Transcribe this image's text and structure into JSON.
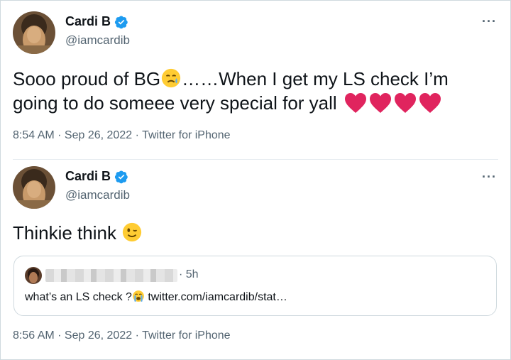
{
  "tweets": [
    {
      "name": "Cardi B",
      "handle": "@iamcardib",
      "more": "···",
      "text_part1": "Sooo proud of BG",
      "text_part2": "……When I get my LS check I’m going to do someee very special for yall ",
      "emojis": [
        "holding-back-tears-emoji",
        "heart-icon",
        "heart-icon",
        "heart-icon",
        "heart-icon"
      ],
      "time": "8:54 AM",
      "sep": " · ",
      "date": "Sep 26, 2022",
      "source": "Twitter for iPhone"
    },
    {
      "name": "Cardi B",
      "handle": "@iamcardib",
      "more": "···",
      "text": "Thinkie think ",
      "emojis": [
        "winking-face-emoji"
      ],
      "time": "8:56 AM",
      "sep": " · ",
      "date": "Sep 26, 2022",
      "source": "Twitter for iPhone",
      "quote": {
        "time": "· 5h",
        "text": "what’s an LS check ?",
        "link": " twitter.com/iamcardib/stat…",
        "emojis": [
          "crying-face-emoji"
        ]
      }
    }
  ],
  "colors": {
    "text": "#0f1419",
    "secondary": "#536471",
    "verified": "#1d9bf0",
    "heart": "#e0245e",
    "border": "#cfd9de"
  }
}
